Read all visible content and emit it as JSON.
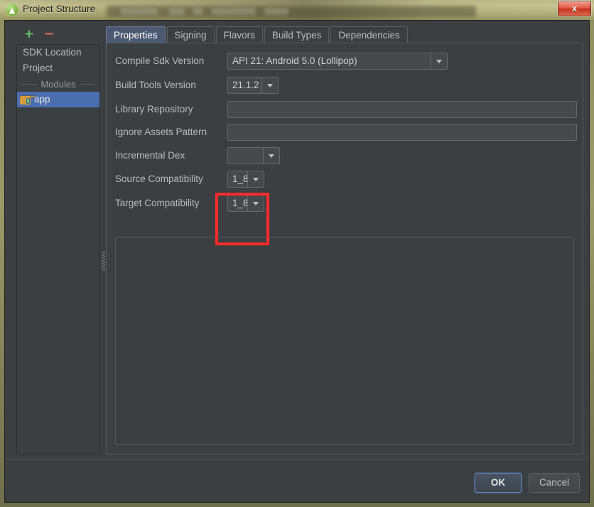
{
  "window": {
    "title": "Project Structure",
    "app_icon": "android-studio-icon",
    "close_label": "x"
  },
  "sidebar": {
    "add_label": "+",
    "remove_label": "−",
    "items": [
      {
        "label": "SDK Location",
        "type": "item",
        "selected": false
      },
      {
        "label": "Project",
        "type": "item",
        "selected": false
      },
      {
        "label": "Modules",
        "type": "separator",
        "selected": false
      },
      {
        "label": "app",
        "type": "module",
        "selected": true
      }
    ]
  },
  "tabs": [
    {
      "label": "Properties",
      "active": true
    },
    {
      "label": "Signing",
      "active": false
    },
    {
      "label": "Flavors",
      "active": false
    },
    {
      "label": "Build Types",
      "active": false
    },
    {
      "label": "Dependencies",
      "active": false
    }
  ],
  "form": {
    "fields": [
      {
        "label": "Compile Sdk Version",
        "value": "API 21: Android 5.0 (Lollipop)",
        "control": "combo-wide"
      },
      {
        "label": "Build Tools Version",
        "value": "21.1.2",
        "control": "combo-small"
      },
      {
        "label": "Library Repository",
        "value": "",
        "control": "text"
      },
      {
        "label": "Ignore Assets Pattern",
        "value": "",
        "control": "text"
      },
      {
        "label": "Incremental Dex",
        "value": "",
        "control": "combo-blank"
      },
      {
        "label": "Source Compatibility",
        "value": "1_8",
        "control": "combo-tiny"
      },
      {
        "label": "Target Compatibility",
        "value": "1_8",
        "control": "combo-tiny"
      }
    ]
  },
  "annotation": {
    "color": "#fc2b2b",
    "note": "highlight around Source/Target Compatibility combos"
  },
  "footer": {
    "ok_label": "OK",
    "cancel_label": "Cancel"
  }
}
